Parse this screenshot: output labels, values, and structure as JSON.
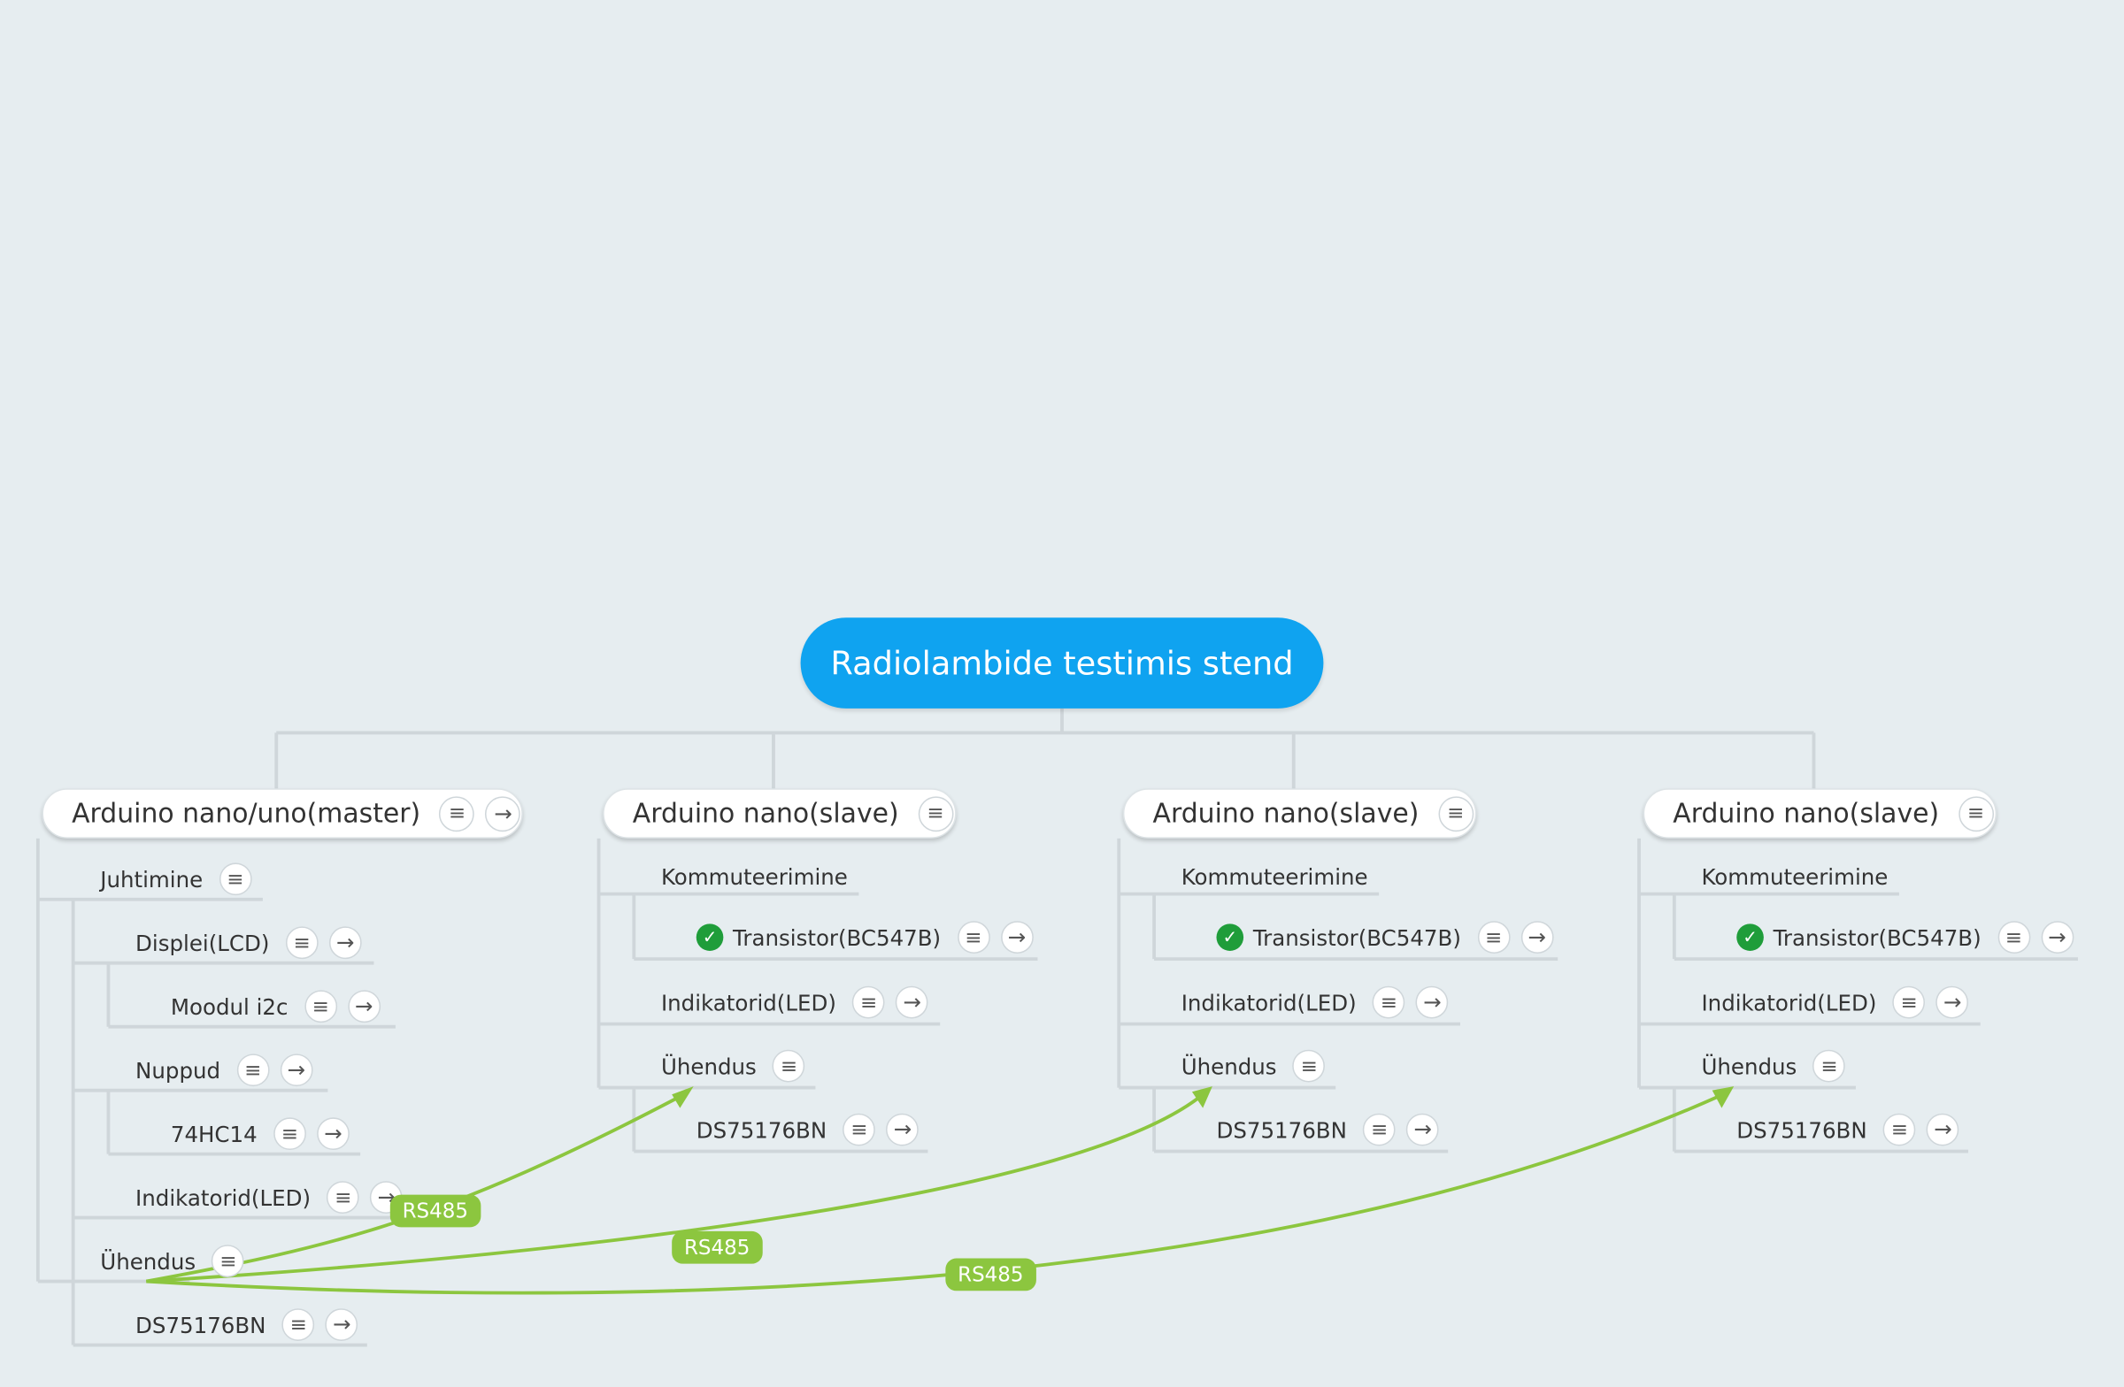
{
  "root": {
    "label": "Radiolambide testimis stend"
  },
  "branches": {
    "master": {
      "label": "Arduino nano/uno(master)",
      "juhtimine": "Juhtimine",
      "displei": "Displei(LCD)",
      "moodul": "Moodul i2c",
      "nuppud": "Nuppud",
      "hc14": "74HC14",
      "indikatorid": "Indikatorid(LED)",
      "uhendus": "Ühendus",
      "ds": "DS75176BN"
    },
    "slave1": {
      "label": "Arduino nano(slave)",
      "kommuteerimine": "Kommuteerimine",
      "transistor": "Transistor(BC547B)",
      "indikatorid": "Indikatorid(LED)",
      "uhendus": "Ühendus",
      "ds": "DS75176BN"
    },
    "slave2": {
      "label": "Arduino nano(slave)",
      "kommuteerimine": "Kommuteerimine",
      "transistor": "Transistor(BC547B)",
      "indikatorid": "Indikatorid(LED)",
      "uhendus": "Ühendus",
      "ds": "DS75176BN"
    },
    "slave3": {
      "label": "Arduino nano(slave)",
      "kommuteerimine": "Kommuteerimine",
      "transistor": "Transistor(BC547B)",
      "indikatorid": "Indikatorid(LED)",
      "uhendus": "Ühendus",
      "ds": "DS75176BN"
    }
  },
  "relationships": [
    {
      "label": "RS485",
      "from": "master.uhendus",
      "to": "slave1.uhendus"
    },
    {
      "label": "RS485",
      "from": "master.uhendus",
      "to": "slave2.uhendus"
    },
    {
      "label": "RS485",
      "from": "master.uhendus",
      "to": "slave3.uhendus"
    }
  ],
  "icons": {
    "notes": "notes-icon",
    "link": "arrow-right-icon",
    "task": "check-circle-icon"
  },
  "colors": {
    "background": "#e6edf0",
    "root": "#0fa3f0",
    "relationship": "#8cc63f",
    "task_done": "#1f9d3a",
    "connector": "#cfd6da"
  }
}
